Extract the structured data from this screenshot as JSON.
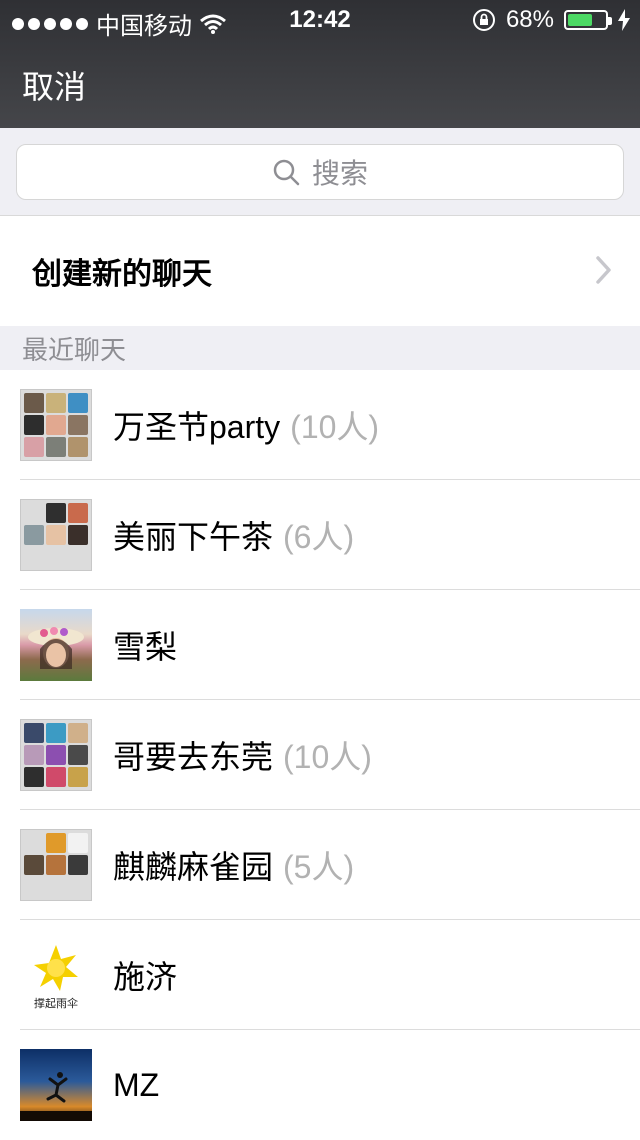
{
  "status_bar": {
    "carrier": "中国移动",
    "time": "12:42",
    "battery_percent": "68%",
    "battery_level": 0.68,
    "battery_color": "#4cd964"
  },
  "nav": {
    "cancel_label": "取消"
  },
  "search": {
    "placeholder": "搜索",
    "icon": "search-icon"
  },
  "create_chat": {
    "label": "创建新的聊天",
    "icon": "chevron-right-icon"
  },
  "recent": {
    "header": "最近聊天",
    "chats": [
      {
        "name": "万圣节party",
        "count": "(10人)",
        "avatar": "group-grid-avatar"
      },
      {
        "name": "美丽下午茶",
        "count": "(6人)",
        "avatar": "group-grid-avatar"
      },
      {
        "name": "雪梨",
        "count": "",
        "avatar": "photo-avatar"
      },
      {
        "name": "哥要去东莞",
        "count": "(10人)",
        "avatar": "group-grid-avatar"
      },
      {
        "name": "麒麟麻雀园",
        "count": "(5人)",
        "avatar": "group-grid-avatar"
      },
      {
        "name": "施济",
        "count": "",
        "avatar": "umbrella-logo-avatar",
        "avatar_text": "撑起雨伞"
      },
      {
        "name": "MZ",
        "count": "",
        "avatar": "sunset-photo-avatar"
      }
    ]
  }
}
